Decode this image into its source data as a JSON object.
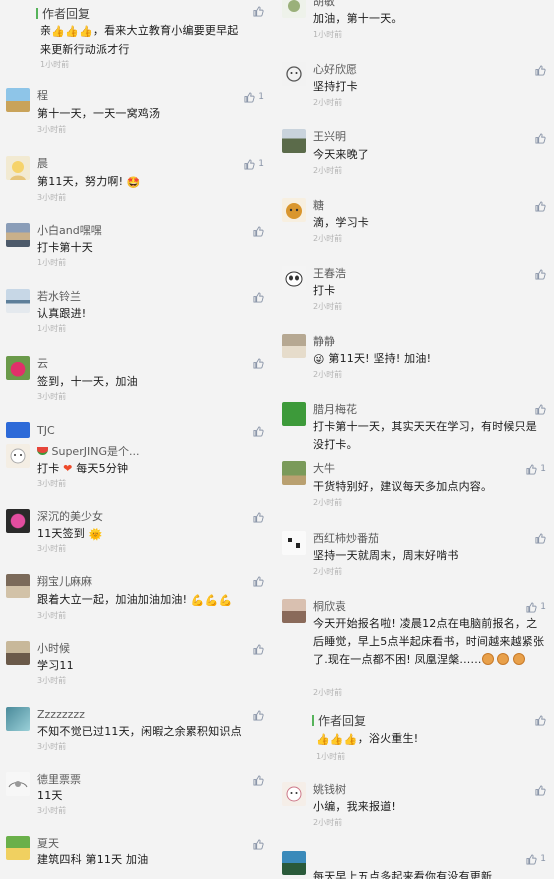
{
  "left": [
    {
      "kind": "reply",
      "name": "作者回复",
      "text": "亲👍👍👍，看来大立教育小编要更早起来更新行动派才行",
      "time": "1小时前",
      "likes": ""
    },
    {
      "name": "程",
      "text": "第十一天，一天一窝鸡汤",
      "time": "3小时前",
      "likes": "1"
    },
    {
      "name": "晨",
      "text": "第11天，努力啊! 🤩",
      "time": "3小时前",
      "likes": "1"
    },
    {
      "name": "小白and嘿嘿",
      "text": "打卡第十天",
      "time": "1小时前",
      "likes": ""
    },
    {
      "name": "若水铃兰",
      "text": "认真跟进!",
      "time": "1小时前",
      "likes": ""
    },
    {
      "name": "云",
      "text": "签到，十一天，加油",
      "time": "3小时前",
      "likes": ""
    },
    {
      "name": "TJC",
      "text": "",
      "time": "",
      "likes": ""
    },
    {
      "name": "🍉 SuperJING是个...",
      "text": "打卡 ❤ 每天5分钟",
      "time": "3小时前",
      "likes": ""
    },
    {
      "name": "深沉的美少女",
      "text": "11天签到 🌞",
      "time": "3小时前",
      "likes": ""
    },
    {
      "name": "翔宝儿麻麻",
      "text": "跟着大立一起，加油加油加油! 💪💪💪",
      "time": "3小时前",
      "likes": ""
    },
    {
      "name": "小时候",
      "text": "学习11",
      "time": "3小时前",
      "likes": ""
    },
    {
      "name": "Zzzzzzzz",
      "text": "不知不觉已过11天，闲暇之余累积知识点",
      "time": "3小时前",
      "likes": ""
    },
    {
      "name": "德里票票",
      "text": "11天",
      "time": "3小时前",
      "likes": ""
    },
    {
      "name": "夏天",
      "text": "建筑四科 第11天 加油",
      "time": "",
      "likes": ""
    }
  ],
  "right": [
    {
      "name": "胡敏",
      "text": "加油，第十一天。",
      "time": "1小时前",
      "likes": ""
    },
    {
      "name": "心好欣愿",
      "text": "坚持打卡",
      "time": "2小时前",
      "likes": ""
    },
    {
      "name": "王兴明",
      "text": "今天来晚了",
      "time": "2小时前",
      "likes": ""
    },
    {
      "name": "糖",
      "text": "滴，学习卡",
      "time": "2小时前",
      "likes": ""
    },
    {
      "name": "王春浩",
      "text": "打卡",
      "time": "2小时前",
      "likes": ""
    },
    {
      "name": "静静",
      "text": "😜 第11天! 坚持! 加油!",
      "time": "2小时前",
      "likes": ""
    },
    {
      "name": "腊月梅花",
      "text": "打卡第十一天，其实天天在学习，有时候只是没打卡。",
      "time": "",
      "likes": ""
    },
    {
      "name": "大牛",
      "text": "干货特别好，建议每天多加点内容。",
      "time": "2小时前",
      "likes": "1"
    },
    {
      "name": "西红柿炒番茄",
      "text": "坚持一天就周末，周末好啃书",
      "time": "2小时前",
      "likes": ""
    },
    {
      "name": "桐欣袁",
      "text": "今天开始报名啦! 凌晨12点在电脑前报名，之后睡觉，早上5点半起床看书，时间越来越紧张了.现在一点都不困! 凤凰涅槃......🍪🍪🍪",
      "time": "2小时前",
      "likes": "1"
    },
    {
      "kind": "reply",
      "name": "作者回复",
      "text": "👍👍👍，浴火重生!",
      "time": "1小时前",
      "likes": ""
    },
    {
      "name": "姚钱树",
      "text": "小编，我来报道!",
      "time": "2小时前",
      "likes": ""
    },
    {
      "name": "",
      "text": "每天早上五点多起来看你有没有更新",
      "time": "",
      "likes": "1"
    }
  ],
  "colors": {
    "background": "#f3f3f3",
    "reply_bar": "#56b35a",
    "like_icon": "#8a95a8",
    "time_text": "#b3b3b3"
  },
  "icons": {
    "like": "thumbs-up-icon"
  }
}
